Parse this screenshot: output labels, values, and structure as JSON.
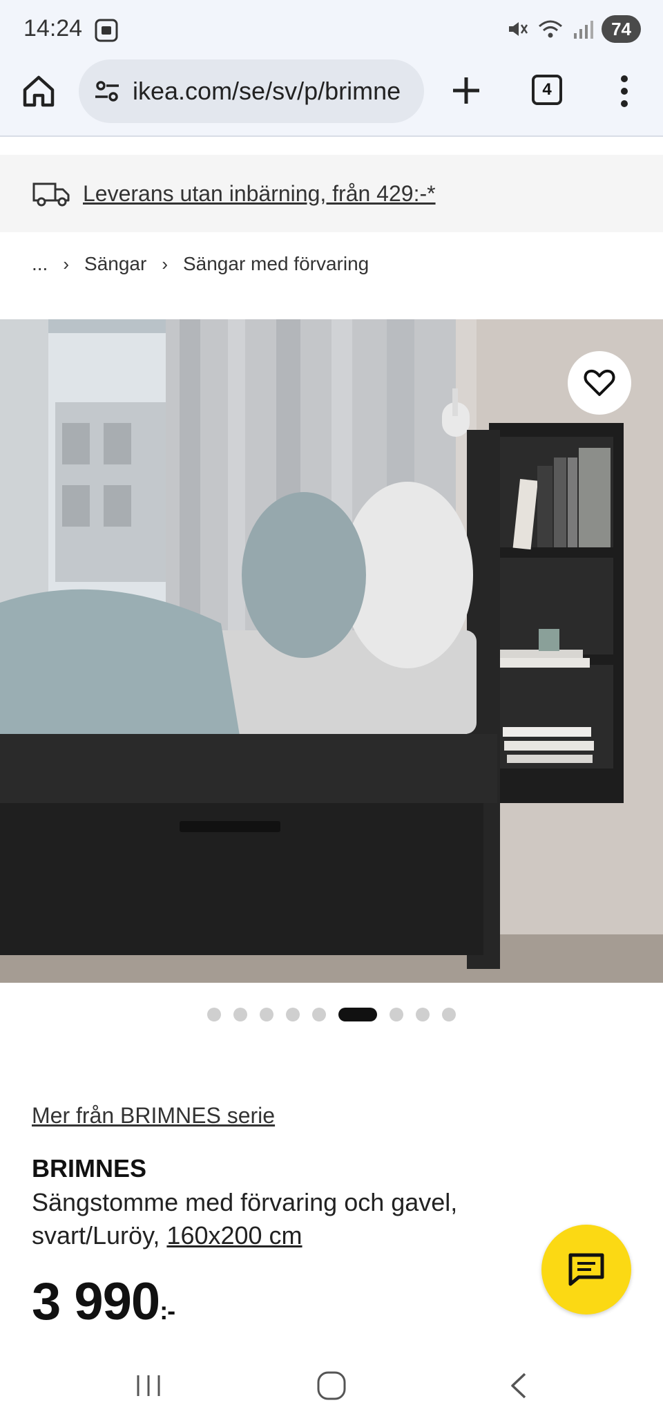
{
  "status_bar": {
    "time": "14:24",
    "battery": "74"
  },
  "browser": {
    "url": "ikea.com/se/sv/p/brimne",
    "tab_count": "4"
  },
  "delivery_banner": {
    "text": "Leverans utan inbärning, från 429:-*"
  },
  "breadcrumb": {
    "ellipsis": "...",
    "items": [
      "Sängar",
      "Sängar med förvaring"
    ]
  },
  "carousel": {
    "total": 9,
    "active_index": 5
  },
  "product": {
    "series_link": "Mer från BRIMNES serie",
    "name": "BRIMNES",
    "description": "Sängstomme med förvaring och gavel, svart/Luröy,",
    "size_link": "160x200 cm",
    "price": "3 990",
    "price_suffix": ":-"
  },
  "icons": {
    "home": "home-icon",
    "site_settings": "tune-icon",
    "new_tab": "plus-icon",
    "menu": "more-vert-icon",
    "delivery": "truck-icon",
    "favorite": "heart-icon",
    "chat": "chat-icon"
  },
  "colors": {
    "chat_fab": "#fbd914",
    "active_dot": "#111111",
    "inactive_dot": "#cfcfcf"
  }
}
